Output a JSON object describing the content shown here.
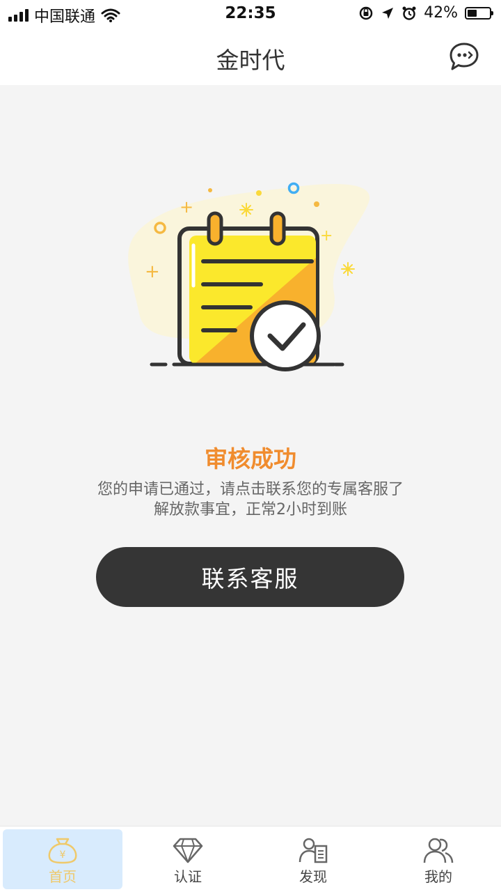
{
  "status_bar": {
    "carrier": "中国联通",
    "time": "22:35",
    "battery": "42%",
    "battery_level": 0.42
  },
  "navbar": {
    "title": "金时代",
    "chat_icon": "chat-bubble-icon"
  },
  "result": {
    "illustration": "approved-notepad-checkmark",
    "title": "审核成功",
    "desc_line1": "您的申请已通过，请点击联系您的专属客服了",
    "desc_line2": "解放款事宜，正常2小时到账",
    "button_label": "联系客服"
  },
  "tabbar": {
    "items": [
      {
        "label": "首页",
        "icon": "money-bag-icon",
        "active": true
      },
      {
        "label": "认证",
        "icon": "diamond-icon",
        "active": false
      },
      {
        "label": "发现",
        "icon": "user-document-icon",
        "active": false
      },
      {
        "label": "我的",
        "icon": "users-icon",
        "active": false
      }
    ]
  },
  "colors": {
    "accent": "#f08c2e",
    "button_bg": "#353535",
    "active_tab_bg": "#d8ebfd",
    "active_tab_text": "#efc96a",
    "page_bg": "#f4f4f4"
  }
}
